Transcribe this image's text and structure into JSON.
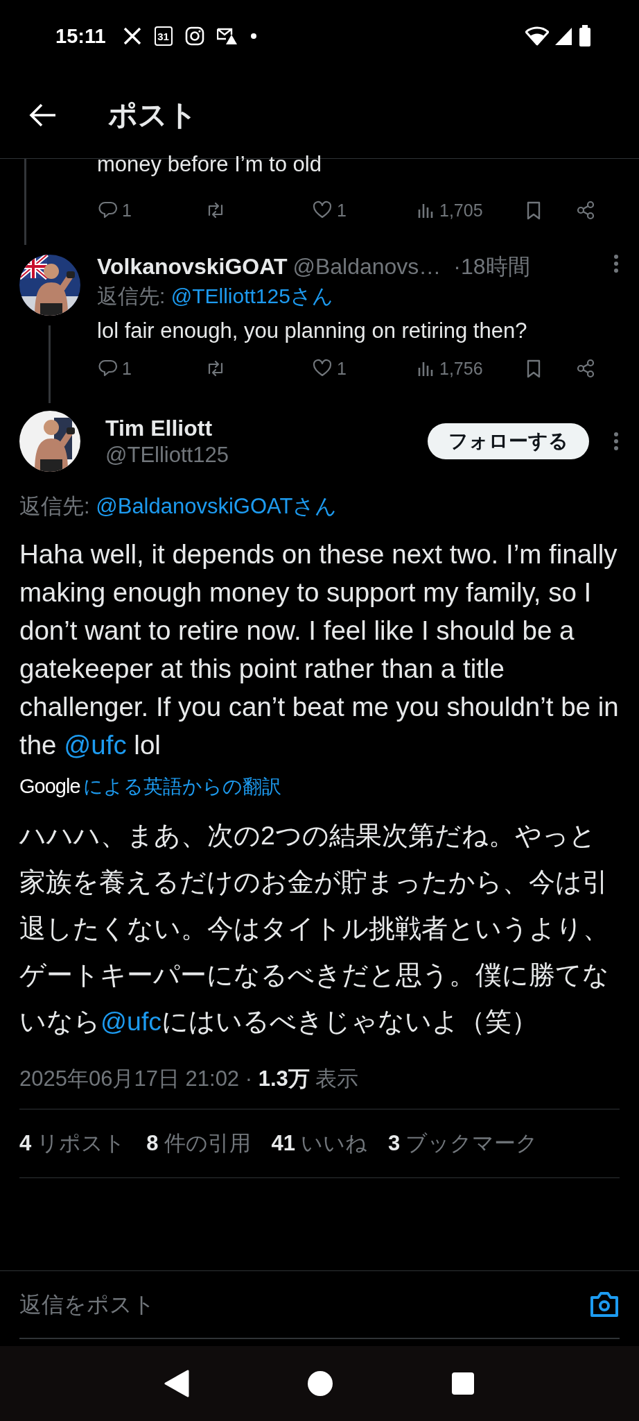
{
  "status_bar": {
    "time": "15:11",
    "calendar_day": "31"
  },
  "header": {
    "title": "ポスト"
  },
  "thread": [
    {
      "kind": "tail",
      "text": "money before I’m to old",
      "actions": {
        "replies": "1",
        "likes": "1",
        "views": "1,705"
      }
    },
    {
      "kind": "reply",
      "name": "VolkanovskiGOAT",
      "handle": "@Baldanovs…",
      "time": "·18時間",
      "reply_label": "返信先:",
      "reply_to": "@TElliott125さん",
      "text": "lol fair enough, you planning on retiring then?",
      "actions": {
        "replies": "1",
        "likes": "1",
        "views": "1,756"
      }
    }
  ],
  "main_post": {
    "name": "Tim Elliott",
    "handle": "@TElliott125",
    "follow_button": "フォローする",
    "reply_label": "返信先:",
    "reply_to": "@BaldanovskiGOATさん",
    "text": [
      {
        "kind": "plain",
        "text": "Haha well, it depends on these next two. I’m finally making enough money to support my family, so I don’t want to retire now. I feel like I should be a gatekeeper at this point rather than a title challenger. If you can’t beat me you shouldn’t be in the "
      },
      {
        "kind": "link",
        "text": "@ufc"
      },
      {
        "kind": "plain",
        "text": " lol"
      }
    ],
    "translation_provider": "Google",
    "translation_label": "による英語からの翻訳",
    "translated_text": [
      {
        "kind": "plain",
        "text": "ハハハ、まあ、次の2つの結果次第だね。やっと家族を養えるだけのお金が貯まったから、今は引退したくない。今はタイトル挑戦者というより、ゲートキーパーになるべきだと思う。僕に勝てないなら"
      },
      {
        "kind": "link",
        "text": "@ufc"
      },
      {
        "kind": "plain",
        "text": "にはいるべきじゃないよ（笑）"
      }
    ],
    "timestamp": "2025年06月17日 21:02 ·",
    "views_count": "1.3万",
    "views_label": "表示",
    "stats": [
      {
        "count": "4",
        "label": "リポスト"
      },
      {
        "count": "8",
        "label": "件の引用"
      },
      {
        "count": "41",
        "label": "いいね"
      },
      {
        "count": "3",
        "label": "ブックマーク"
      }
    ]
  },
  "reply_box": {
    "placeholder": "返信をポスト"
  }
}
